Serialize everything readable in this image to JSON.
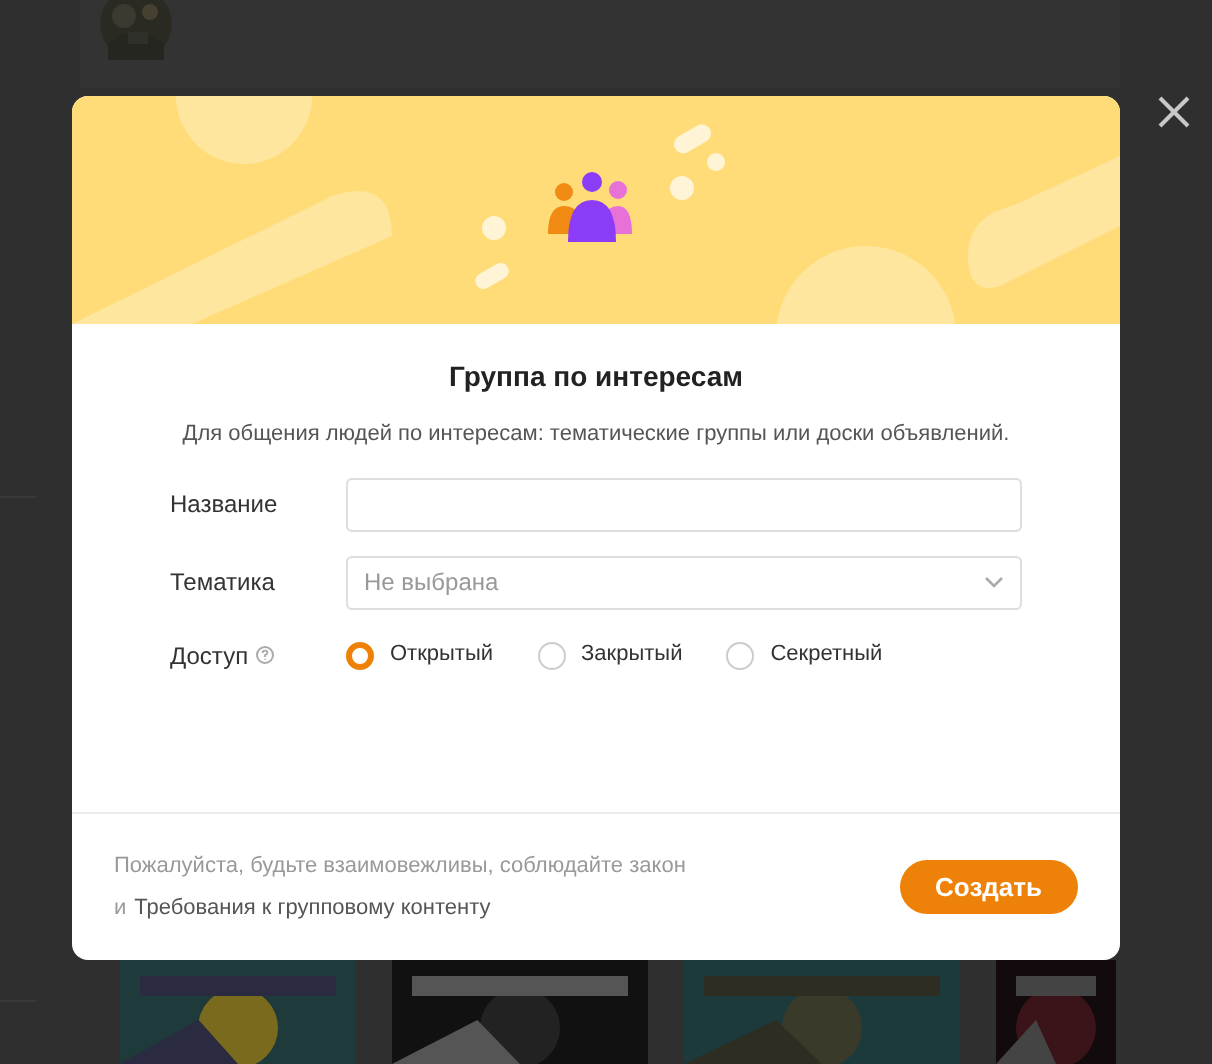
{
  "dialog": {
    "title": "Группа по интересам",
    "subtitle": "Для общения людей по интересам: тематические группы или доски объявлений.",
    "fields": [
      {
        "kind": "text",
        "label": "Название"
      },
      {
        "kind": "select",
        "label": "Тематика",
        "placeholder": "Не выбрана"
      }
    ],
    "access": {
      "label": "Доступ",
      "options": [
        {
          "label": "Открытый",
          "selected": true
        },
        {
          "label": "Закрытый",
          "selected": false
        },
        {
          "label": "Секретный",
          "selected": false
        }
      ]
    },
    "footer_text": "Пожалуйста, будьте взаимовежливы, соблюдайте закон",
    "footer_prefix": "и",
    "footer_link": "Требования к групповому контенту",
    "create_button": "Создать"
  }
}
